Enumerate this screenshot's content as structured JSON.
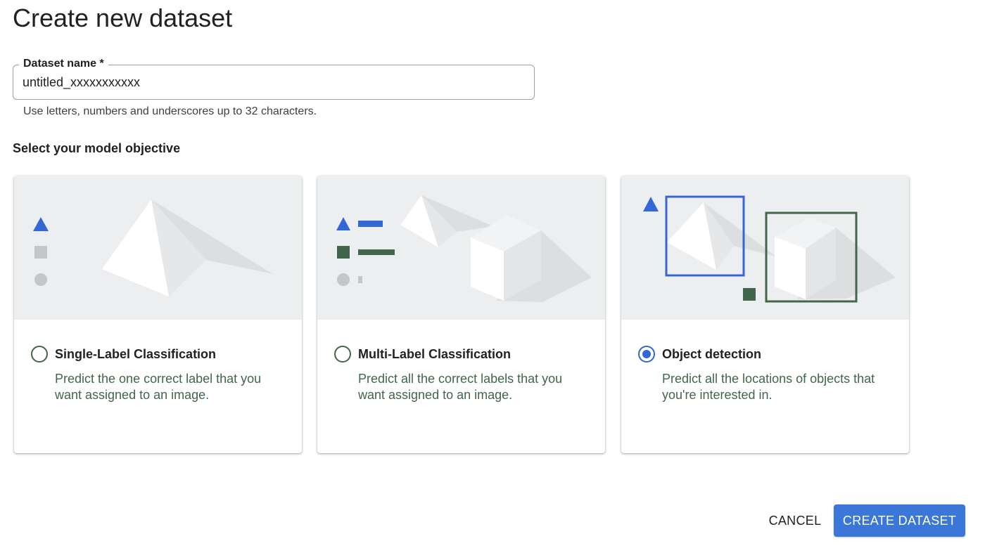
{
  "header": {
    "title": "Create new dataset"
  },
  "dataset_name": {
    "label": "Dataset name *",
    "value": "untitled_xxxxxxxxxxx",
    "helper": "Use letters, numbers and underscores up to 32 characters."
  },
  "objective": {
    "title": "Select your model objective",
    "options": [
      {
        "title": "Single-Label Classification",
        "description": "Predict the one correct label that you want assigned to an image.",
        "selected": false
      },
      {
        "title": "Multi-Label Classification",
        "description": "Predict all the correct labels that you want assigned to an image.",
        "selected": false
      },
      {
        "title": "Object detection",
        "description": "Predict all the locations of objects that you're interested in.",
        "selected": true
      }
    ]
  },
  "actions": {
    "cancel_label": "CANCEL",
    "create_label": "CREATE DATASET"
  },
  "colors": {
    "accent_blue": "#3b76d9",
    "label_green": "#41664c",
    "art_background": "#edeef0"
  }
}
